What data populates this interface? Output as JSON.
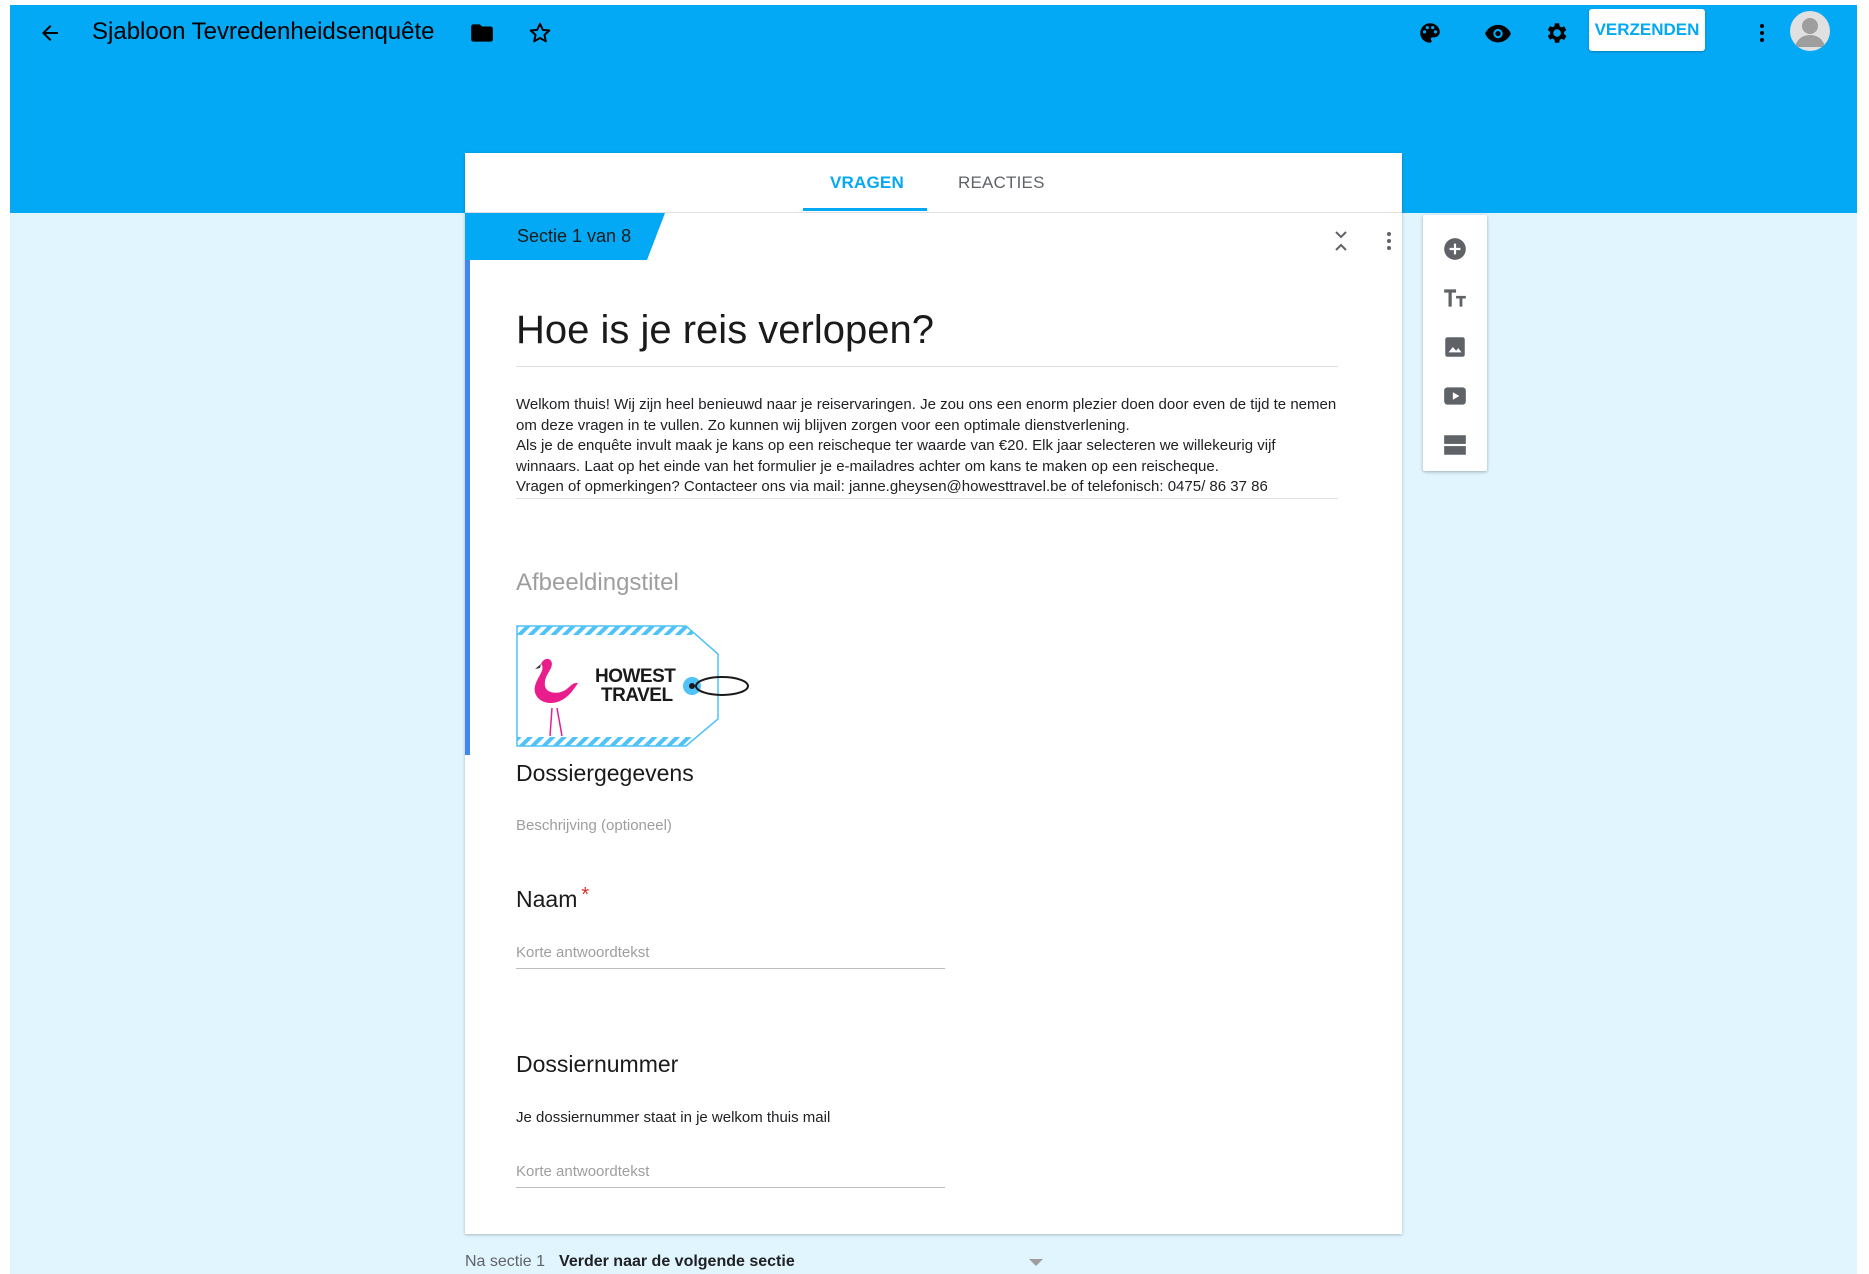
{
  "topbar": {
    "title": "Sjabloon Tevredenheidsenquête",
    "send_label": "VERZENDEN",
    "icons": [
      "back-arrow-icon",
      "folder-icon",
      "star-icon",
      "palette-icon",
      "eye-icon",
      "gear-icon",
      "more-vert-icon",
      "avatar"
    ]
  },
  "tabs": [
    {
      "label": "VRAGEN",
      "active": true
    },
    {
      "label": "REACTIES",
      "active": false
    }
  ],
  "section": {
    "label": "Sectie 1 van 8",
    "title": "Hoe is je reis verlopen?",
    "description_lines": [
      "Welkom thuis! Wij zijn heel benieuwd naar je reiservaringen. Je zou ons een enorm plezier doen door even de tijd te nemen",
      "om deze vragen in te vullen. Zo kunnen wij blijven zorgen voor een optimale dienstverlening.",
      "Als je de enquête invult maak je kans op een reischeque ter waarde van €20. Elk jaar selecteren we willekeurig vijf",
      "winnaars. Laat op het einde van het formulier je e-mailadres achter om kans te maken op een reischeque.",
      "Vragen of opmerkingen? Contacteer ons via mail: janne.gheysen@howesttravel.be of telefonisch: 0475/ 86 37 86"
    ]
  },
  "image_item": {
    "title_placeholder": "Afbeeldingstitel",
    "logo_line1": "HOWEST",
    "logo_line2": "TRAVEL"
  },
  "items": [
    {
      "title": "Dossiergegevens",
      "description": "Beschrijving (optioneel)"
    },
    {
      "title": "Naam",
      "required_mark": "*",
      "answer_placeholder": "Korte antwoordtekst"
    },
    {
      "title": "Dossiernummer",
      "description": "Je dossiernummer staat in je welkom thuis mail",
      "answer_placeholder": "Korte antwoordtekst"
    }
  ],
  "after_section": {
    "label": "Na sectie 1",
    "value": "Verder naar de volgende sectie"
  },
  "side_toolbar": [
    "add-question-icon",
    "title-text-icon",
    "image-icon",
    "video-icon",
    "section-icon"
  ],
  "colors": {
    "theme": "#03a9f4",
    "background": "#e1f5fe",
    "accent_blue": "#4285f4",
    "required": "#d93025"
  }
}
